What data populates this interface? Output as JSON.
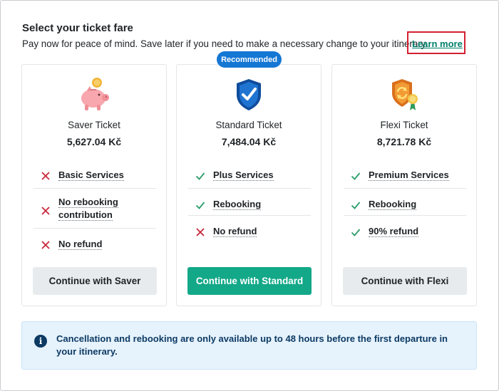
{
  "header": {
    "title": "Select your ticket fare",
    "subtitle": "Pay now for peace of mind. Save later if you need to make a necessary change to your itinerary.",
    "learn_more": "Learn more"
  },
  "badge": "Recommended",
  "cards": [
    {
      "name": "Saver Ticket",
      "price": "5,627.04 Kč",
      "icon": "piggy-bank-icon",
      "features": [
        {
          "label": "Basic Services",
          "included": false
        },
        {
          "label": "No rebooking contribution",
          "included": false
        },
        {
          "label": "No refund",
          "included": false
        }
      ],
      "button": "Continue with Saver"
    },
    {
      "name": "Standard Ticket",
      "price": "7,484.04 Kč",
      "icon": "shield-check-icon",
      "features": [
        {
          "label": "Plus Services",
          "included": true
        },
        {
          "label": "Rebooking",
          "included": true
        },
        {
          "label": "No refund",
          "included": false
        }
      ],
      "button": "Continue with Standard"
    },
    {
      "name": "Flexi Ticket",
      "price": "8,721.78 Kč",
      "icon": "refresh-shield-icon",
      "features": [
        {
          "label": "Premium Services",
          "included": true
        },
        {
          "label": "Rebooking",
          "included": true
        },
        {
          "label": "90% refund",
          "included": true
        }
      ],
      "button": "Continue with Flexi"
    }
  ],
  "info": {
    "icon": "info-icon",
    "text": "Cancellation and rebooking are only available up to 48 hours before the first departure in your itinerary."
  },
  "colors": {
    "accent_green": "#13a888",
    "link_green": "#00806b",
    "badge_blue": "#1577d4",
    "cross_red": "#c8283a",
    "check_green": "#2a9d6a",
    "info_bg": "#e6f3fd",
    "info_text": "#0d3a63",
    "highlight_red": "#d32030"
  }
}
